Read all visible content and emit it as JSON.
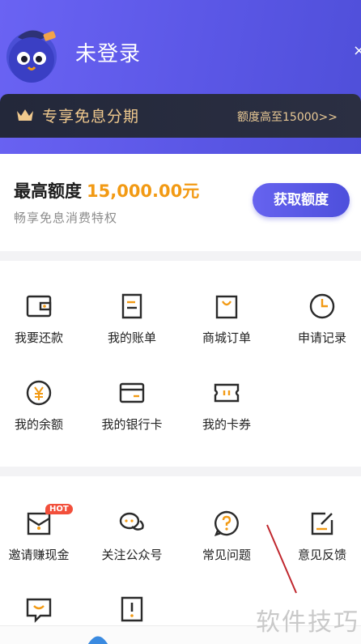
{
  "header": {
    "login_status": "未登录",
    "close": "×",
    "vip_title": "专享免息分期",
    "vip_limit": "额度高至15000>>"
  },
  "credit": {
    "label": "最高额度",
    "amount": "15,000.00元",
    "subtitle": "畅享免息消费特权",
    "button": "获取额度"
  },
  "grid1": [
    {
      "label": "我要还款",
      "icon": "wallet-icon"
    },
    {
      "label": "我的账单",
      "icon": "bill-icon"
    },
    {
      "label": "商城订单",
      "icon": "shopping-bag-icon"
    },
    {
      "label": "申请记录",
      "icon": "clock-icon"
    },
    {
      "label": "我的余额",
      "icon": "yen-coin-icon"
    },
    {
      "label": "我的银行卡",
      "icon": "bank-card-icon"
    },
    {
      "label": "我的卡券",
      "icon": "ticket-icon"
    }
  ],
  "grid2": [
    {
      "label": "邀请赚现金",
      "icon": "envelope-icon",
      "badge": "HOT"
    },
    {
      "label": "关注公众号",
      "icon": "chat-bubbles-icon"
    },
    {
      "label": "常见问题",
      "icon": "question-icon"
    },
    {
      "label": "意见反馈",
      "icon": "feedback-icon"
    }
  ],
  "grid3": [
    {
      "icon": "message-smile-icon"
    },
    {
      "icon": "warning-icon"
    }
  ],
  "watermark": "软件技巧",
  "colors": {
    "brand": "#5b57e6",
    "accent": "#f29a14",
    "icon_stroke": "#2a2a2a",
    "icon_accent": "#f29a14",
    "hot_badge": "#f24f3b"
  }
}
